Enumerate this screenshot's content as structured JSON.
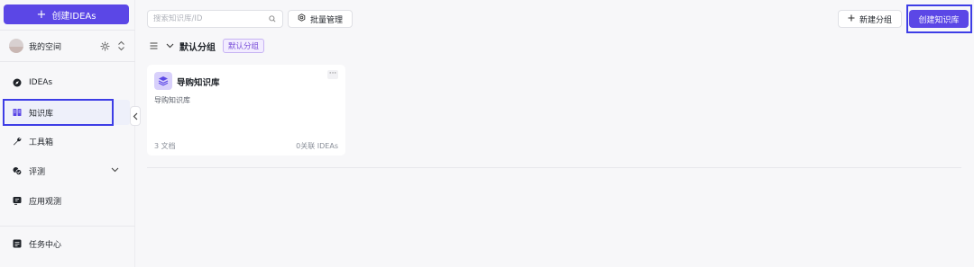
{
  "sidebar": {
    "create_label": "创建IDEAs",
    "space_name": "我的空间",
    "items": [
      {
        "label": "IDEAs",
        "icon": "compass-icon"
      },
      {
        "label": "知识库",
        "icon": "book-icon"
      },
      {
        "label": "工具箱",
        "icon": "wrench-icon"
      },
      {
        "label": "评测",
        "icon": "evaluation-icon"
      },
      {
        "label": "应用观测",
        "icon": "monitor-icon"
      }
    ],
    "task_center": "任务中心"
  },
  "toolbar": {
    "search_placeholder": "搜索知识库/ID",
    "batch_label": "批量管理",
    "new_group_label": "新建分组",
    "create_kb_label": "创建知识库"
  },
  "group": {
    "title": "默认分组",
    "badge": "默认分组"
  },
  "cards": [
    {
      "title": "导购知识库",
      "description": "导购知识库",
      "docs": "3 文档",
      "ideas": "0关联 IDEAs"
    }
  ],
  "colors": {
    "accent": "#5b47e6",
    "highlight": "#3d3de6",
    "badge_text": "#7a4fd8"
  }
}
